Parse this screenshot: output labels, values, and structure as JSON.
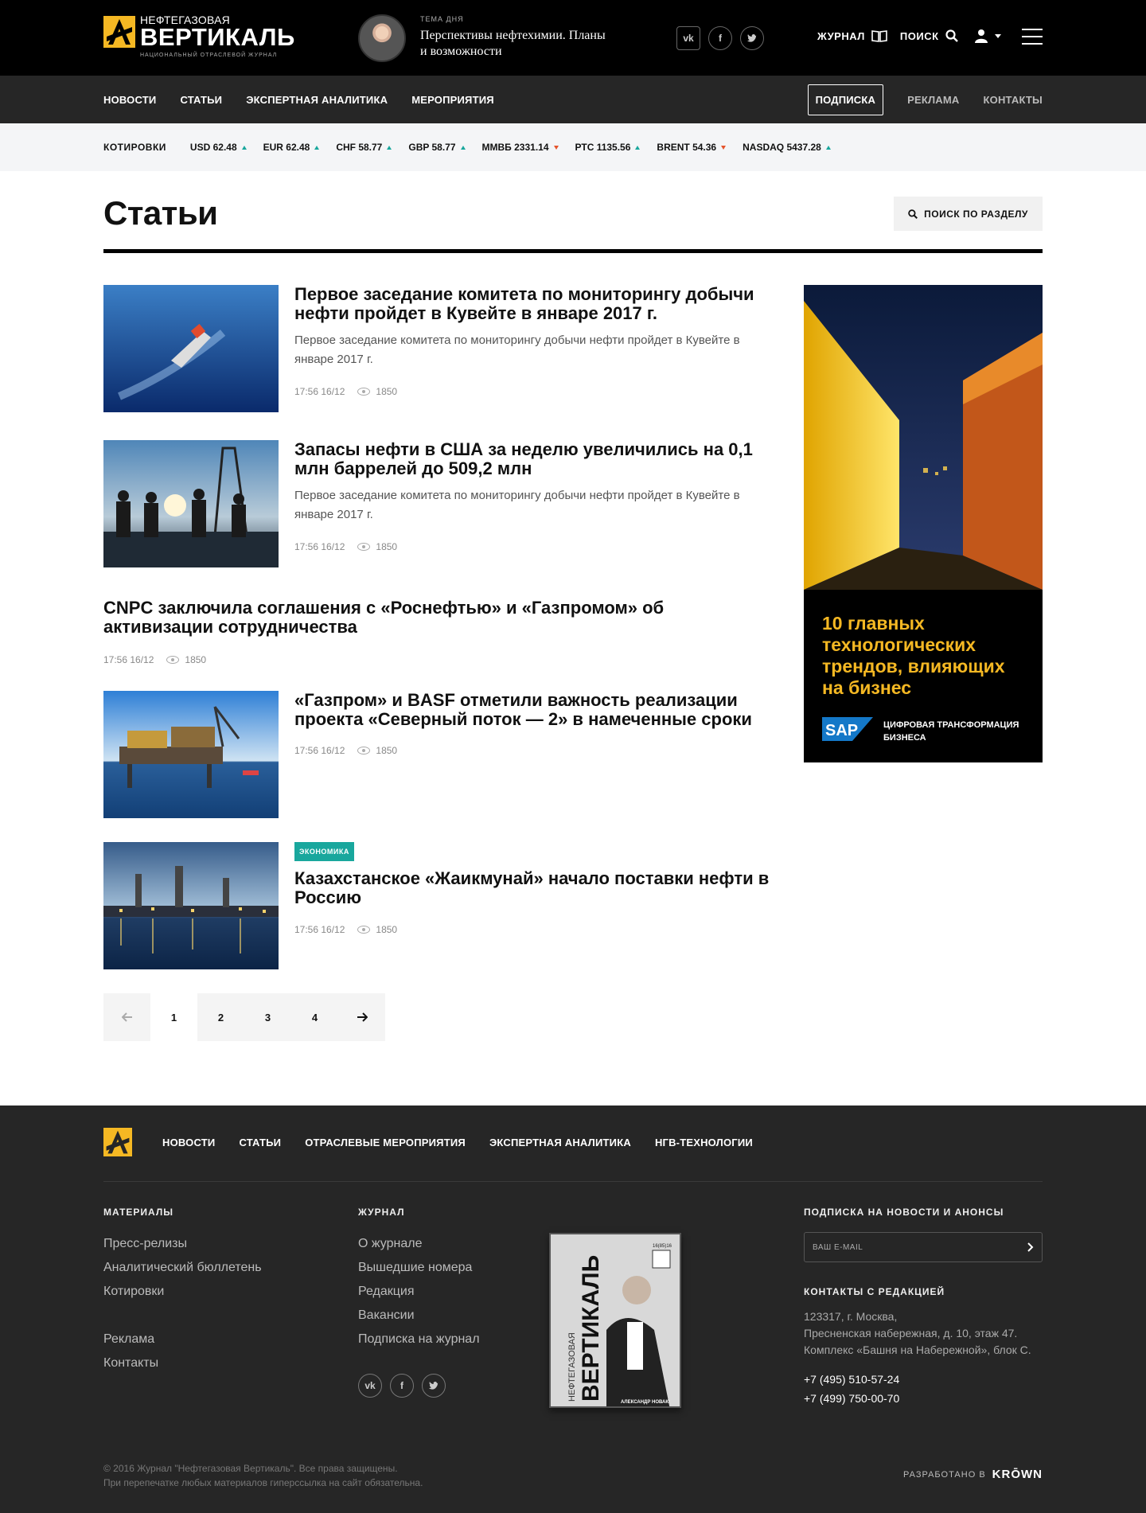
{
  "header": {
    "logo": {
      "line1": "НЕФТЕГАЗОВАЯ",
      "line2": "ВЕРТИКАЛЬ",
      "line3": "НАЦИОНАЛЬНЫЙ ОТРАСЛЕВОЙ ЖУРНАЛ"
    },
    "topic_label": "ТЕМА ДНЯ",
    "topic_text": "Перспективы нефтехимии. Планы и возможности",
    "social": [
      "vk-icon",
      "facebook-icon",
      "twitter-icon"
    ],
    "journal_label": "ЖУРНАЛ",
    "search_label": "ПОИСК"
  },
  "nav": {
    "items": [
      "НОВОСТИ",
      "СТАТЬИ",
      "ЭКСПЕРТНАЯ АНАЛИТИКА",
      "МЕРОПРИЯТИЯ"
    ],
    "subscribe": "ПОДПИСКА",
    "ads": "РЕКЛАМА",
    "contacts": "КОНТАКТЫ"
  },
  "quotes": {
    "label": "КОТИРОВКИ",
    "items": [
      {
        "text": "USD 62.48",
        "trend": "up"
      },
      {
        "text": "EUR 62.48",
        "trend": "up"
      },
      {
        "text": "CHF 58.77",
        "trend": "up"
      },
      {
        "text": "GBP 58.77",
        "trend": "up"
      },
      {
        "text": "ММВБ 2331.14",
        "trend": "down"
      },
      {
        "text": "РТС 1135.56",
        "trend": "up"
      },
      {
        "text": "BRENT 54.36",
        "trend": "down"
      },
      {
        "text": "NASDAQ 5437.28",
        "trend": "up"
      }
    ],
    "up_color": "#19a79d",
    "down_color": "#e5542b"
  },
  "page": {
    "title": "Статьи",
    "section_search": "ПОИСК ПО РАЗДЕЛУ"
  },
  "articles": [
    {
      "title": "Первое заседание комитета по мониторингу добычи нефти пройдет в Кувейте в январе 2017 г.",
      "lead": "Первое заседание комитета по мониторингу добычи нефти пройдет в Кувейте в январе 2017 г.",
      "time": "17:56 16/12",
      "views": "1850"
    },
    {
      "title": "Запасы нефти в США за неделю увеличились на 0,1 млн баррелей до 509,2 млн",
      "lead": "Первое заседание комитета по мониторингу добычи нефти пройдет в Кувейте в январе 2017 г.",
      "time": "17:56 16/12",
      "views": "1850"
    },
    {
      "title": "CNPC заключила соглашения с «Роснефтью» и «Газпромом» об активизации сотрудничества",
      "time": "17:56 16/12",
      "views": "1850"
    },
    {
      "title": "«Газпром» и BASF отметили важность реализации проекта «Северный поток — 2» в намеченные сроки",
      "time": "17:56 16/12",
      "views": "1850"
    },
    {
      "tag": "ЭКОНОМИКА",
      "title": "Казахстанское «Жаикмунай» начало поставки нефти в Россию",
      "time": "17:56 16/12",
      "views": "1850"
    }
  ],
  "ad": {
    "headline": "10 главных технологических трендов, влияющих на бизнес",
    "brand": "SAP",
    "subline": "ЦИФРОВАЯ ТРАНСФОРМАЦИЯ БИЗНЕСА"
  },
  "pagination": {
    "pages": [
      "1",
      "2",
      "3",
      "4"
    ],
    "current": "1"
  },
  "footer": {
    "nav": [
      "НОВОСТИ",
      "СТАТЬИ",
      "ОТРАСЛЕВЫЕ МЕРОПРИЯТИЯ",
      "ЭКСПЕРТНАЯ АНАЛИТИКА",
      "НГВ-ТЕХНОЛОГИИ"
    ],
    "materials_title": "МАТЕРИАЛЫ",
    "materials": [
      "Пресс-релизы",
      "Аналитический бюллетень",
      "Котировки"
    ],
    "materials2": [
      "Реклама",
      "Контакты"
    ],
    "journal_title": "ЖУРНАЛ",
    "journal": [
      "О журнале",
      "Вышедшие номера",
      "Редакция",
      "Вакансии",
      "Подписка на журнал"
    ],
    "cover": {
      "title_small": "НЕФТЕГАЗОВАЯ",
      "title": "ВЕРТИКАЛЬ",
      "issue": "16(85)16",
      "person": "АЛЕКСАНДР НОВАК:"
    },
    "subscribe_title": "ПОДПИСКА НА НОВОСТИ И АНОНСЫ",
    "email_placeholder": "ВАШ E-MAIL",
    "contacts_title": "КОНТАКТЫ С РЕДАКЦИЕЙ",
    "address": [
      "123317, г. Москва,",
      "Пресненская набережная, д. 10, этаж 47.",
      "Комплекс «Башня на Набережной», блок С."
    ],
    "phones": [
      "+7 (495) 510-57-24",
      "+7 (499) 750-00-70"
    ],
    "copyright": [
      "© 2016 Журнал \"Нефтегазовая Вертикаль\". Все права защищены.",
      "При перепечатке любых материалов гиперссылка на сайт обязательна."
    ],
    "dev_label": "РАЗРАБОТАНО В",
    "dev_name": "KRŌWN"
  },
  "colors": {
    "accent": "#f5b823",
    "tag": "#19a79d",
    "header_bg": "#000000",
    "nav_bg": "#262626"
  }
}
